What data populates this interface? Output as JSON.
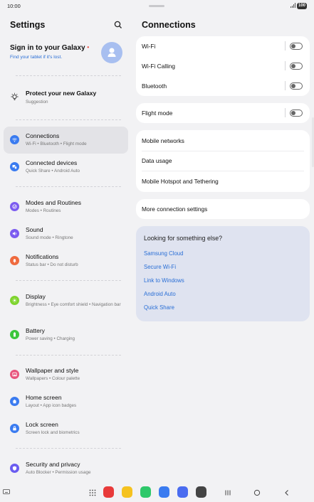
{
  "status": {
    "time": "10:00",
    "battery": "100"
  },
  "left": {
    "title": "Settings",
    "signin": {
      "title": "Sign in to your Galaxy",
      "subtitle": "Find your tablet if it's lost."
    },
    "protect": {
      "title": "Protect your new Galaxy",
      "subtitle": "Suggestion"
    },
    "items": [
      {
        "title": "Connections",
        "subtitle": "Wi-Fi  •  Bluetooth  •  Flight mode",
        "color": "#3a7bf0",
        "icon": "wifi-icon"
      },
      {
        "title": "Connected devices",
        "subtitle": "Quick Share  •  Android Auto",
        "color": "#3a7bf0",
        "icon": "connected-devices-icon"
      },
      {
        "title": "Modes and Routines",
        "subtitle": "Modes  •  Routines",
        "color": "#7c5cf0",
        "icon": "modes-icon"
      },
      {
        "title": "Sound",
        "subtitle": "Sound mode  •  Ringtone",
        "color": "#7c5cf0",
        "icon": "sound-icon"
      },
      {
        "title": "Notifications",
        "subtitle": "Status bar  •  Do not disturb",
        "color": "#ef6a3e",
        "icon": "notifications-icon"
      },
      {
        "title": "Display",
        "subtitle": "Brightness  •  Eye comfort shield  •  Navigation bar",
        "color": "#7fd42e",
        "icon": "display-icon"
      },
      {
        "title": "Battery",
        "subtitle": "Power saving  •  Charging",
        "color": "#3cc63c",
        "icon": "battery-icon"
      },
      {
        "title": "Wallpaper and style",
        "subtitle": "Wallpapers  •  Colour palette",
        "color": "#e8547c",
        "icon": "wallpaper-icon"
      },
      {
        "title": "Home screen",
        "subtitle": "Layout  •  App icon badges",
        "color": "#3a7bf0",
        "icon": "home-icon"
      },
      {
        "title": "Lock screen",
        "subtitle": "Screen lock and biometrics",
        "color": "#3a7bf0",
        "icon": "lock-icon"
      },
      {
        "title": "Security and privacy",
        "subtitle": "Auto Blocker  •  Permission usage",
        "color": "#6a5cf0",
        "icon": "shield-icon"
      }
    ]
  },
  "right": {
    "title": "Connections",
    "group1": [
      "Wi-Fi",
      "Wi-Fi Calling",
      "Bluetooth"
    ],
    "flight": "Flight mode",
    "group3": [
      "Mobile networks",
      "Data usage",
      "Mobile Hotspot and Tethering"
    ],
    "more": "More connection settings",
    "looking": {
      "title": "Looking for something else?",
      "links": [
        "Samsung Cloud",
        "Secure Wi-Fi",
        "Link to Windows",
        "Android Auto",
        "Quick Share"
      ]
    }
  },
  "toggles": {
    "wifi": false,
    "wifi_calling": false,
    "bluetooth": false,
    "flight_mode": false
  },
  "dock_colors": [
    "#e83a3a",
    "#f5c21f",
    "#2ec86a",
    "#3a7bf0",
    "#4a6cf0",
    "#444444"
  ],
  "dock_icons": [
    "photo-icon",
    "folder-icon",
    "phone-icon",
    "messages-icon",
    "browser-icon",
    "camera-icon"
  ]
}
